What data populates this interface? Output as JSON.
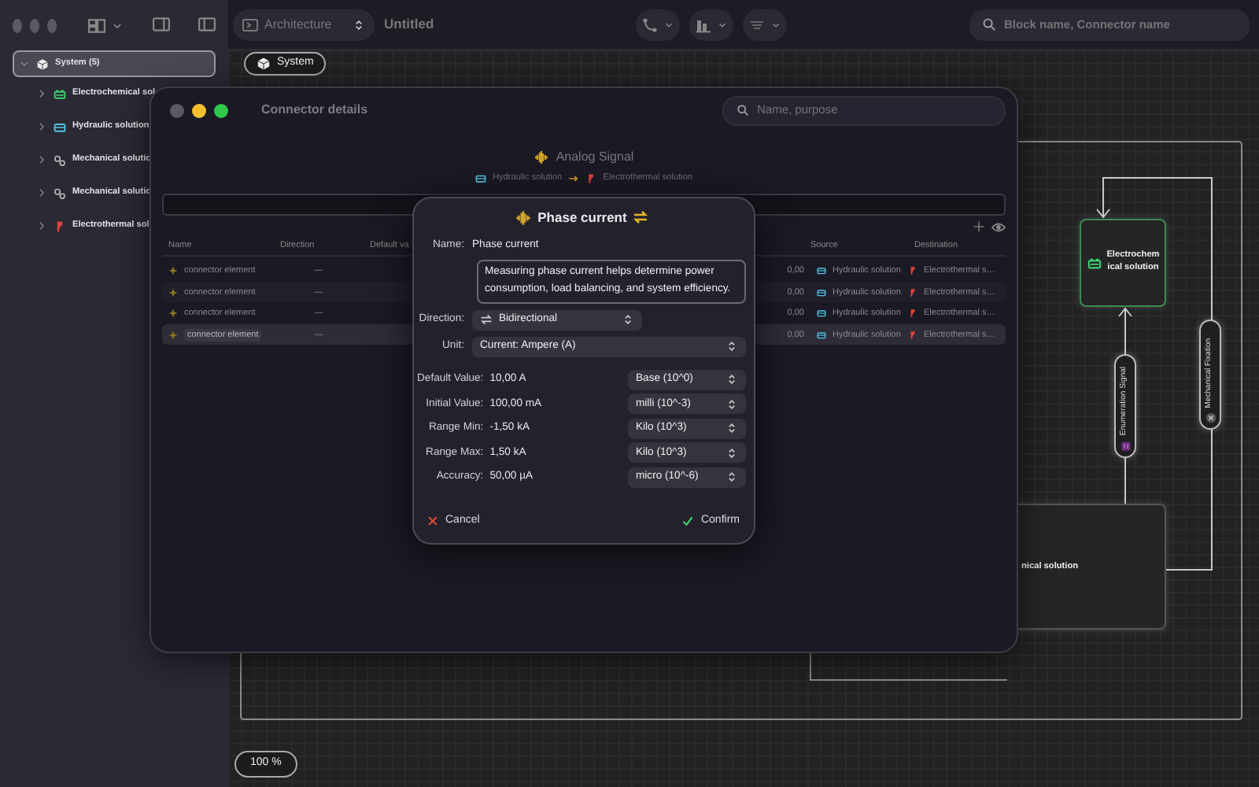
{
  "window": {
    "title": "Untitled"
  },
  "toolbar": {
    "view_selector": "Architecture",
    "search": {
      "placeholder": "Block name, Connector name"
    }
  },
  "sidebar": {
    "items": [
      {
        "label": "System (5)",
        "kind": "system",
        "selected": true,
        "expanded": true,
        "children": [
          {
            "label": "Electrochemical sol",
            "kind": "battery",
            "selected": false,
            "expanded": false
          },
          {
            "label": "Hydraulic solution",
            "kind": "hydraulic",
            "selected": false,
            "expanded": false
          },
          {
            "label": "Mechanical solutio",
            "kind": "gears",
            "selected": false,
            "expanded": false
          },
          {
            "label": "Mechanical solutio",
            "kind": "gears",
            "selected": false,
            "expanded": false
          },
          {
            "label": "Electrothermal sol",
            "kind": "plug",
            "selected": false,
            "expanded": false
          }
        ]
      }
    ]
  },
  "canvas": {
    "breadcrumb": "System",
    "zoom": "100 %",
    "nodes": [
      {
        "label": "Electrochemical solution",
        "kind": "battery"
      },
      {
        "label": "nical solution",
        "kind": "plain"
      }
    ],
    "connectors": [
      {
        "label": "Enumeration Signal",
        "kind": "enumeration"
      },
      {
        "label": "Mechanical Fixation",
        "kind": "mechanical"
      }
    ]
  },
  "connector_details": {
    "title": "Connector details",
    "search": {
      "placeholder": "Name, purpose"
    },
    "signal": "Analog Signal",
    "source": "Hydraulic solution",
    "destination": "Electrothermal solution",
    "table": {
      "columns": [
        "Name",
        "Direction",
        "Default va",
        "Source",
        "Destination"
      ],
      "rows": [
        {
          "name": "connector element",
          "direction": "—",
          "value": "0,00",
          "source": "Hydraulic solution",
          "destination": "Electrothermal s…",
          "selected": false
        },
        {
          "name": "connector element",
          "direction": "—",
          "value": "0,00",
          "source": "Hydraulic solution",
          "destination": "Electrothermal s…",
          "selected": false
        },
        {
          "name": "connector element",
          "direction": "—",
          "value": "0,00",
          "source": "Hydraulic solution",
          "destination": "Electrothermal s…",
          "selected": false
        },
        {
          "name": "connector element",
          "direction": "—",
          "value": "0,00",
          "source": "Hydraulic solution",
          "destination": "Electrothermal s…",
          "selected": true
        }
      ]
    }
  },
  "dialog": {
    "title": "Phase current",
    "name_label": "Name:",
    "name": "Phase current",
    "description": "Measuring phase current helps determine power consumption, load balancing, and system efficiency.",
    "direction_label": "Direction:",
    "direction": "Bidirectional",
    "unit_label": "Unit:",
    "unit": "Current: Ampere (A)",
    "values": [
      {
        "label": "Default Value:",
        "value": "10,00 A",
        "prefix": "Base (10^0)"
      },
      {
        "label": "Initial Value:",
        "value": "100,00 mA",
        "prefix": "milli (10^-3)"
      },
      {
        "label": "Range Min:",
        "value": "-1,50 kA",
        "prefix": "Kilo (10^3)"
      },
      {
        "label": "Range Max:",
        "value": "1,50 kA",
        "prefix": "Kilo (10^3)"
      },
      {
        "label": "Accuracy:",
        "value": "50,00 µA",
        "prefix": "micro (10^-6)"
      }
    ],
    "cancel": "Cancel",
    "confirm": "Confirm"
  }
}
